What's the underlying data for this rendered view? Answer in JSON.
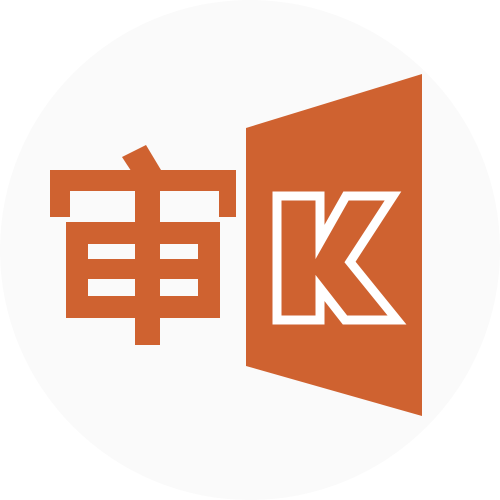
{
  "icon": {
    "name": "审K app logo",
    "glyph": "审",
    "letter": "K",
    "brand_color": "#CF6230",
    "background_color": "#FAFAFA",
    "outline_color": "#FFFFFF"
  }
}
